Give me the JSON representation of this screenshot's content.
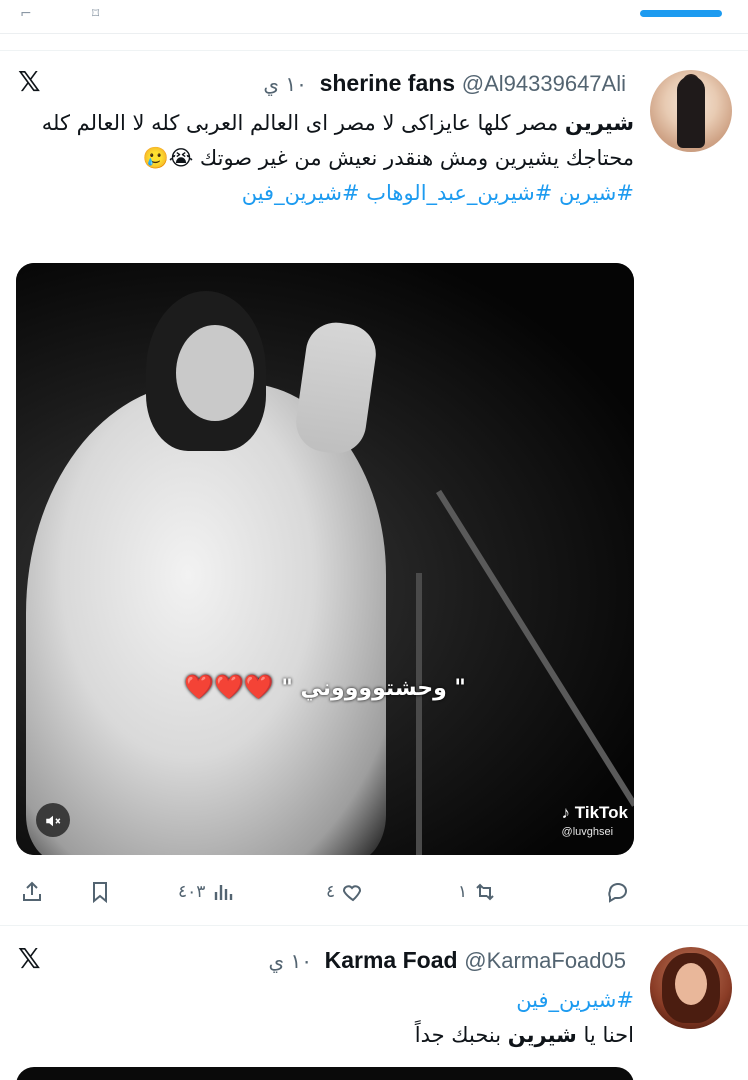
{
  "tweet1": {
    "name": "sherine fans",
    "handle": "@Al94339647Ali",
    "time": "١٠ ي",
    "line1_bold": "شيرين",
    "line1_rest": " مصر كلها عايزاكى لا مصر اى العالم العربى كله لا العالم كله محتاجك يشيرين ومش هنقدر نعيش من غير صوتك 😭🥲",
    "hashtags": "#شيرين #شيرين_عبد_الوهاب #شيرين_فين",
    "video_caption": "\" وحشتووووني \"",
    "video_hearts": "❤️❤️❤️",
    "tiktok_label": "TikTok",
    "tiktok_user": "@luvghsei",
    "stats": {
      "views": "٤٠٣",
      "likes": "٤",
      "retweets": "١"
    }
  },
  "tweet2": {
    "name": "Karma Foad",
    "handle": "@KarmaFoad05",
    "time": "١٠ ي",
    "hashtag": "#شيرين_فين",
    "text_prefix": "احنا يا ",
    "text_bold": "شيرين",
    "text_suffix": " بنحبك جداً"
  },
  "icons": {
    "x_logo": "𝕏",
    "mute": "🔇"
  },
  "colors": {
    "accent": "#1d9bf0",
    "secondary_text": "#536471",
    "heart": "#e0245e"
  }
}
